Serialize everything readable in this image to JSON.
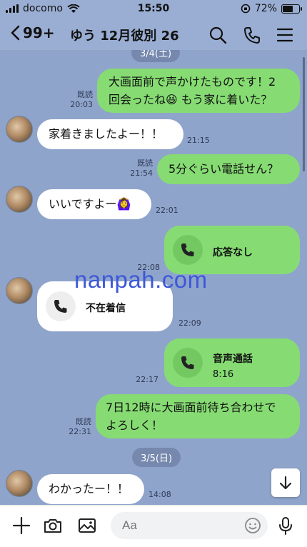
{
  "status_bar": {
    "carrier": "docomo",
    "time": "15:50",
    "battery": "72%",
    "battery_level": 0.72
  },
  "header": {
    "back_count": "99+",
    "title": "ゆう 12月彼別 26"
  },
  "chat": {
    "top_date": "3/4(土)",
    "messages": {
      "m1": {
        "text_line1": "大画面前で声かけたものです！2",
        "text_line2": "回会ったね😆 もう家に着いた？",
        "read": "既読",
        "time": "20:03"
      },
      "m2": {
        "text": "家着きましたよー！！",
        "time": "21:15"
      },
      "m3": {
        "text": "5分ぐらい電話せん？",
        "read": "既読",
        "time": "21:54"
      },
      "m4": {
        "text": "いいですよー🙆‍♀️",
        "time": "22:01"
      },
      "m5": {
        "label": "応答なし",
        "time": "22:08"
      },
      "m6": {
        "label": "不在着信",
        "time": "22:09"
      },
      "m7": {
        "label": "音声通話",
        "duration": "8:16",
        "time": "22:17"
      },
      "m8": {
        "text_line1": "7日12時に大画面前待ち合わせで",
        "text_line2": "よろしく！",
        "read": "既読",
        "time": "22:31"
      },
      "m9": {
        "text": "わかったー！！",
        "time": "14:08"
      }
    },
    "date_divider": "3/5(日)"
  },
  "watermark": "nanpah.com",
  "composer": {
    "placeholder": "Aa"
  },
  "colors": {
    "my_bubble": "#86dc73",
    "their_bubble": "#ffffff",
    "background": "#8fa4cb"
  }
}
